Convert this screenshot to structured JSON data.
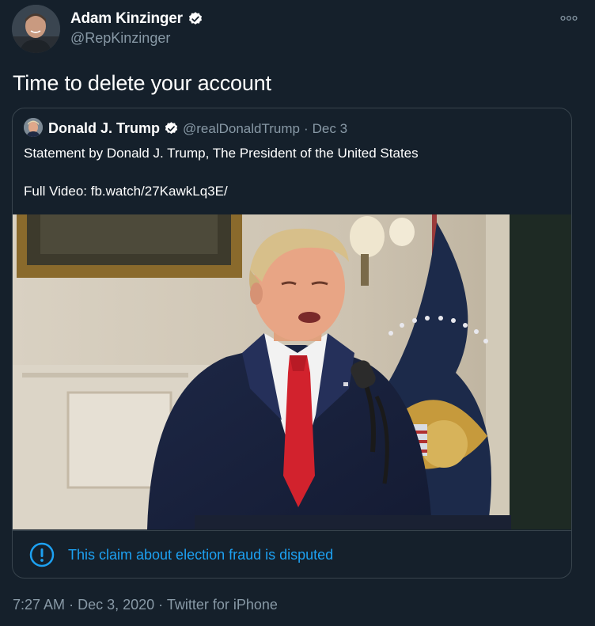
{
  "tweet": {
    "author_name": "Adam Kinzinger",
    "author_handle": "@RepKinzinger",
    "text": "Time to delete your account",
    "more_icon": "more-horizontal-icon",
    "verified_icon": "verified-badge-icon"
  },
  "quote": {
    "author_name": "Donald J. Trump",
    "author_handle": "@realDonaldTrump",
    "separator": "·",
    "date": "Dec 3",
    "text_line_1": "Statement by Donald J. Trump, The President of the United States",
    "text_line_2": "Full Video: fb.watch/27KawkLq3E/",
    "media_icon": "video-thumbnail",
    "notice_icon": "exclamation-circle-icon",
    "notice_text": "This claim about election fraud is disputed"
  },
  "meta": {
    "time": "7:27 AM",
    "sep1": "·",
    "date": "Dec 3, 2020",
    "sep2": "·",
    "source": "Twitter for iPhone"
  },
  "colors": {
    "background": "#15202b",
    "border": "#38444d",
    "secondary_text": "#8899a6",
    "accent": "#1da1f2"
  }
}
